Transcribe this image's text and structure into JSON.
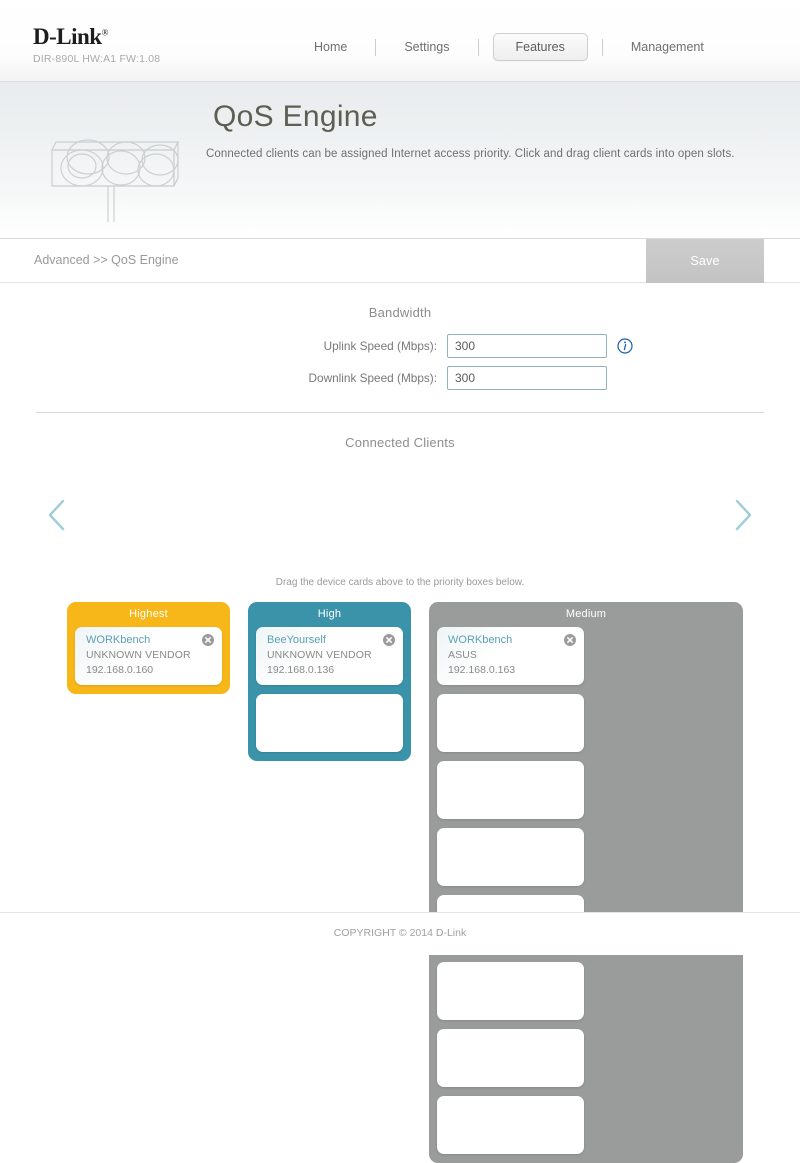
{
  "brand": {
    "name": "D-Link",
    "model_info": "DIR-890L   HW:A1   FW:1.08"
  },
  "nav": {
    "items": [
      {
        "label": "Home",
        "active": false
      },
      {
        "label": "Settings",
        "active": false
      },
      {
        "label": "Features",
        "active": true
      },
      {
        "label": "Management",
        "active": false
      }
    ]
  },
  "header": {
    "title": "QoS Engine",
    "description": "Connected clients can be assigned Internet access priority. Click and drag client cards into open slots.",
    "watermark_icon": "traffic-light-icon"
  },
  "breadcrumb": {
    "text": "Advanced >> QoS Engine"
  },
  "toolbar": {
    "save_label": "Save"
  },
  "bandwidth": {
    "section_title": "Bandwidth",
    "fields": [
      {
        "label": "Uplink Speed (Mbps):",
        "value": "300",
        "placeholder": ""
      },
      {
        "label": "Downlink Speed (Mbps):",
        "value": "300",
        "placeholder": ""
      }
    ],
    "info_icon": "info-circle-icon"
  },
  "clients": {
    "section_title": "Connected Clients",
    "prev_icon": "chevron-left-icon",
    "next_icon": "chevron-right-icon",
    "drag_hint": "Drag the device cards above to the priority boxes below.",
    "cards": []
  },
  "priority": {
    "groups": [
      {
        "title": "Highest",
        "color": "#f7b719",
        "slot_count": 1,
        "slots": [
          {
            "filled": true,
            "name": "WORKbench",
            "vendor": "UNKNOWN VENDOR",
            "ip": "192.168.0.160",
            "close_icon": "close-circle-icon"
          }
        ]
      },
      {
        "title": "High",
        "color": "#3b93aa",
        "slot_count": 2,
        "slots": [
          {
            "filled": true,
            "name": "BeeYourself",
            "vendor": "UNKNOWN VENDOR",
            "ip": "192.168.0.136",
            "close_icon": "close-circle-icon"
          },
          {
            "filled": false
          }
        ]
      },
      {
        "title": "Medium",
        "color": "#9a9b9b",
        "slot_count": 8,
        "slots": [
          {
            "filled": true,
            "name": "WORKbench",
            "vendor": "ASUS",
            "ip": "192.168.0.163",
            "close_icon": "close-circle-icon"
          },
          {
            "filled": false
          },
          {
            "filled": false
          },
          {
            "filled": false
          },
          {
            "filled": false
          },
          {
            "filled": false
          },
          {
            "filled": false
          },
          {
            "filled": false
          }
        ]
      }
    ]
  },
  "footer": {
    "copyright": "COPYRIGHT © 2014 D-Link"
  }
}
